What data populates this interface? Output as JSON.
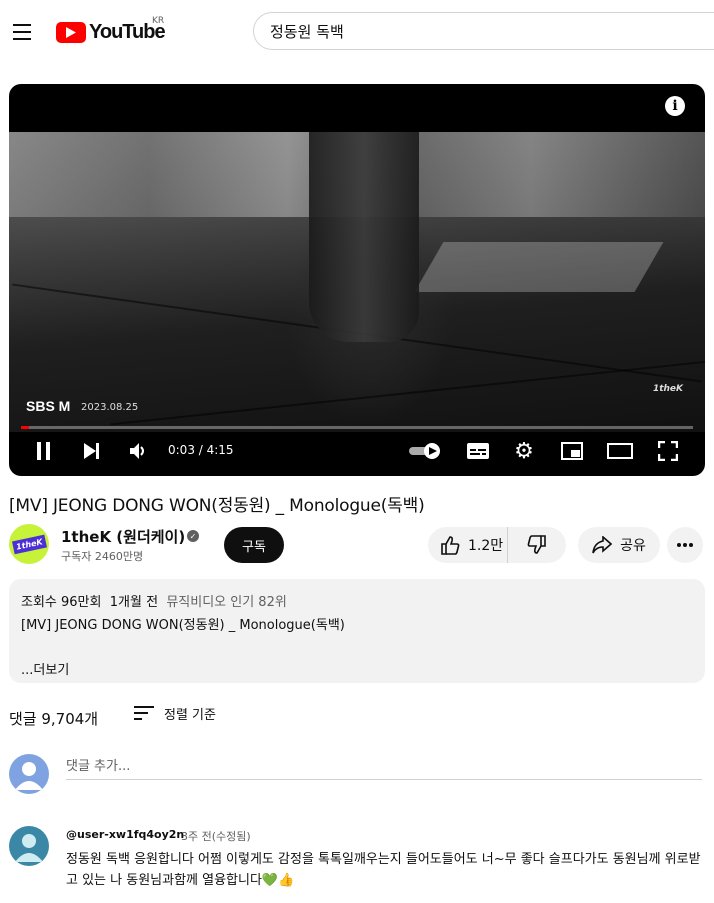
{
  "header": {
    "logo_text": "YouTube",
    "country": "KR",
    "search_value": "정동원 독백"
  },
  "player": {
    "overlay_brand": "SBS M",
    "overlay_date": "2023.08.25",
    "watermark": "1theK",
    "time": "0:03 / 4:15",
    "progress": 0.012,
    "accent_color": "#ff0000"
  },
  "video": {
    "title": "[MV] JEONG DONG WON(정동원) _ Monologue(독백)"
  },
  "channel": {
    "name": "1theK (원더케이)",
    "avatar_text": "1theK",
    "subscribers": "구독자 2460만명",
    "subscribe_label": "구독"
  },
  "actions": {
    "likes": "1.2만",
    "share_label": "공유"
  },
  "description": {
    "views": "조회수 96만회",
    "age": "1개월 전",
    "chart": "뮤직비디오 인기 82위",
    "line1": "[MV] JEONG DONG WON(정동원) _ Monologue(독백)",
    "more_label": "...더보기"
  },
  "comments": {
    "count": "댓글 9,704개",
    "sort_label": "정렬 기준",
    "add_placeholder": "댓글 추가...",
    "items": [
      {
        "author": "@user-xw1fq4oy2n",
        "time": "3주 전(수정됨)",
        "text": "정동원 독백  응원합니다             어쩜 이렇게도 감정을 톡톡일깨우는지 들어도들어도 너~무 좋다  슬프다가도 동원님께 위로받고 있는 나 동원님과함께 열융합니다💚👍"
      }
    ]
  }
}
